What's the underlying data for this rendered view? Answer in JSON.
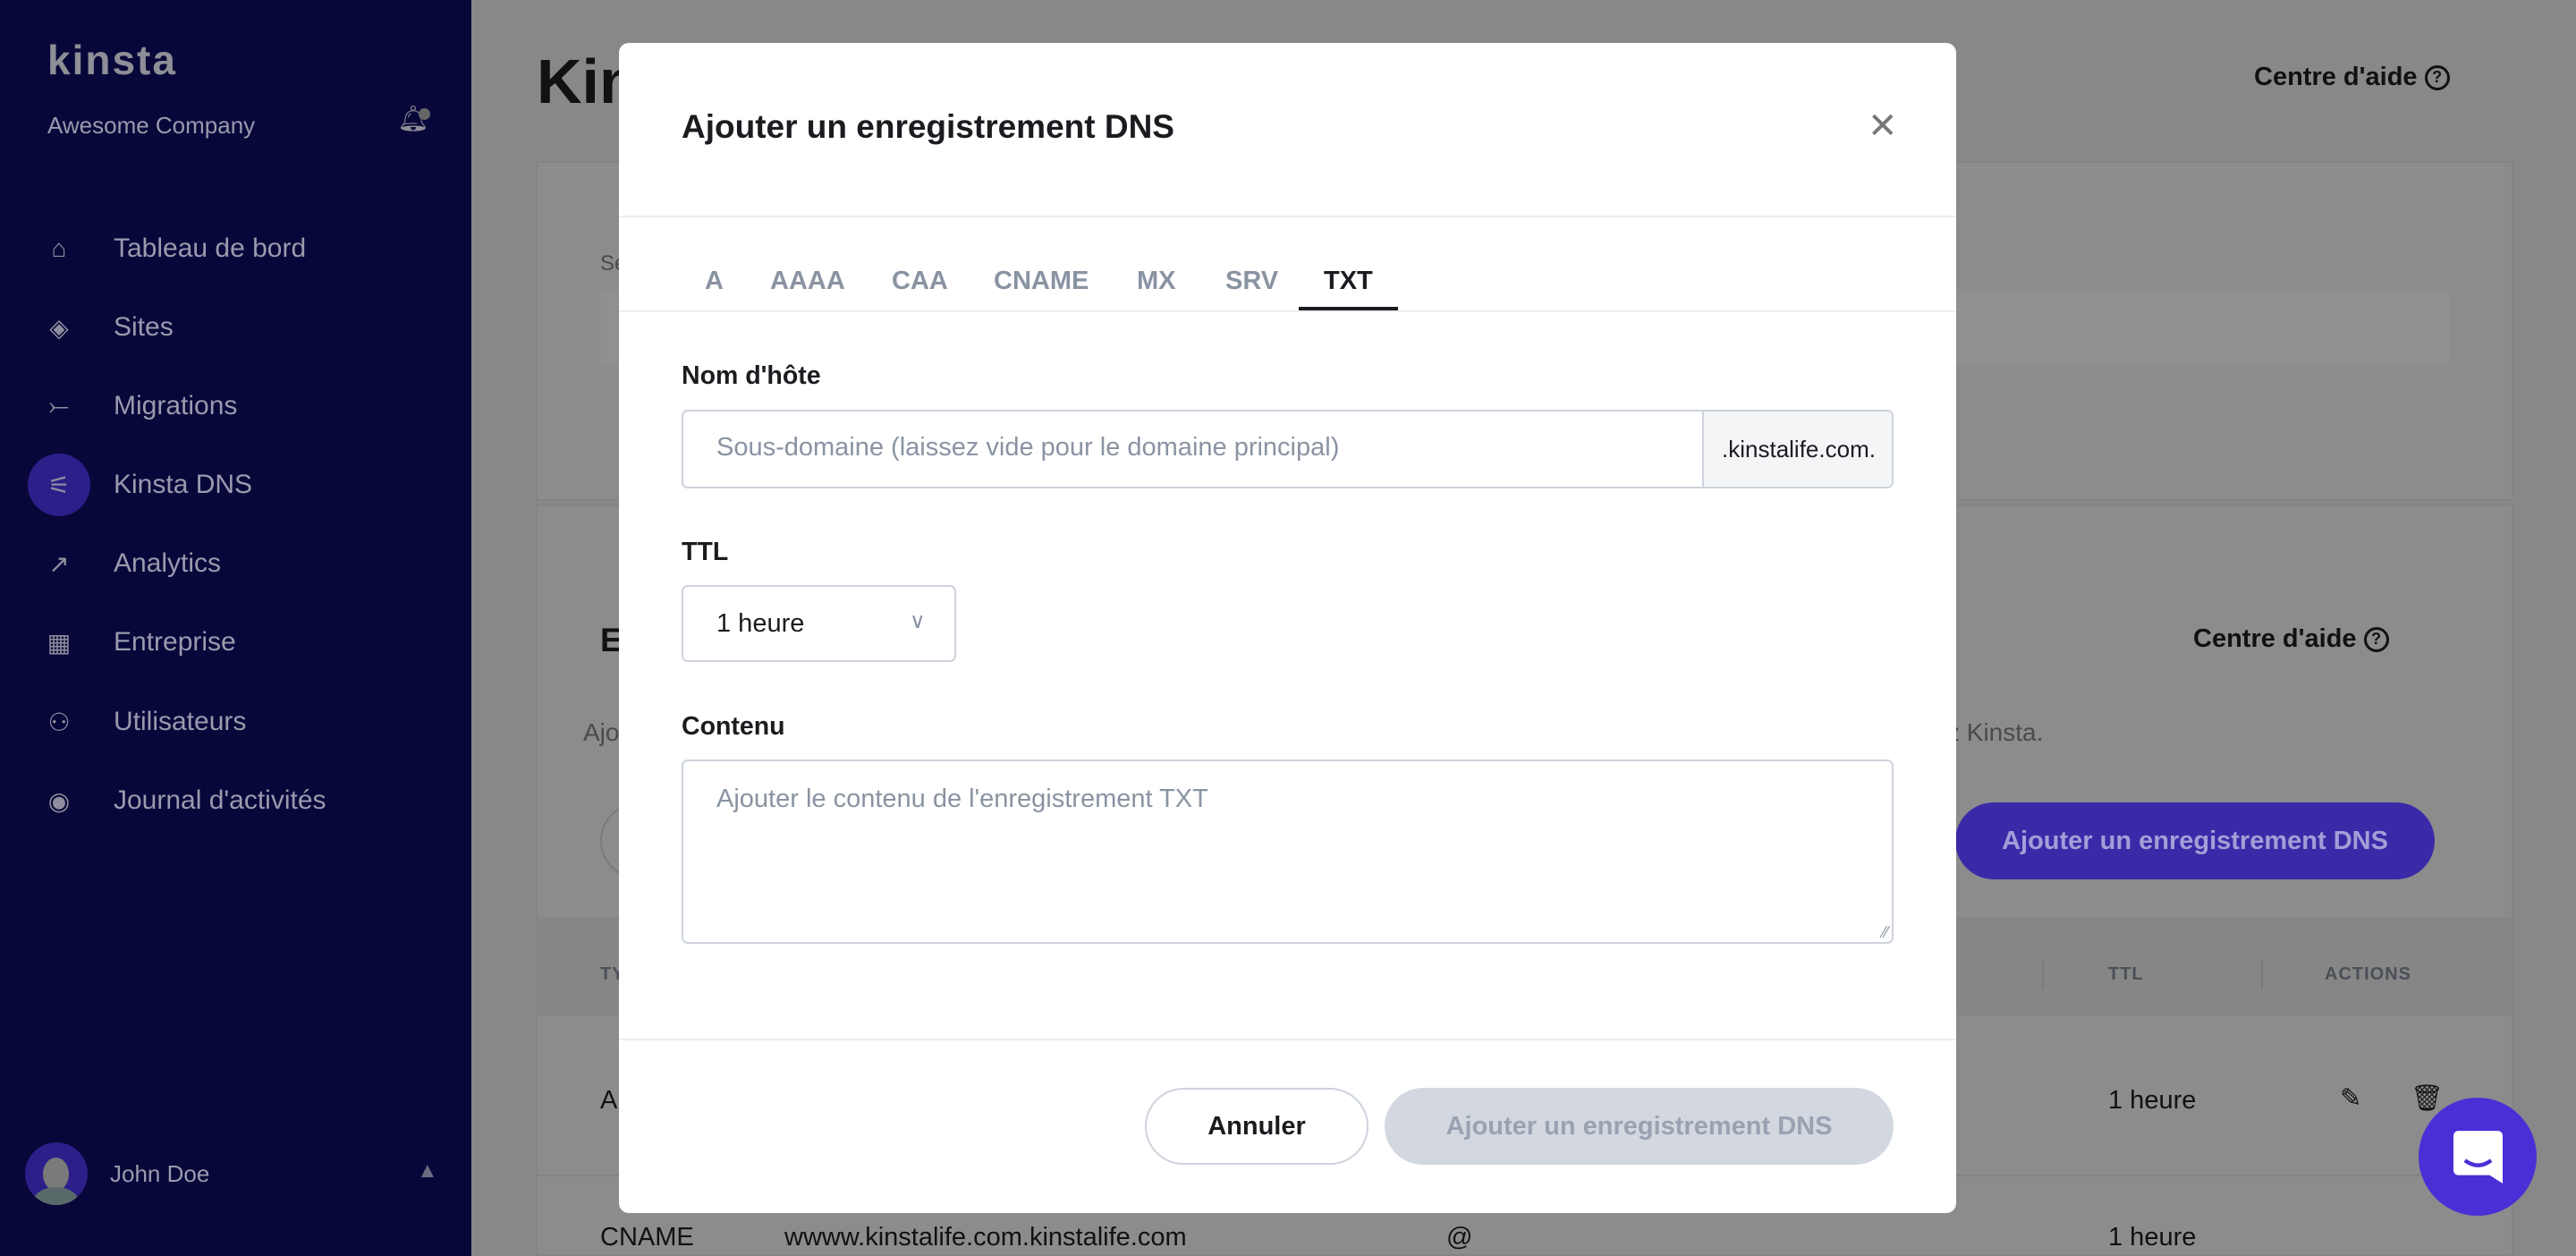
{
  "sidebar": {
    "logo": "kinsta",
    "company": "Awesome Company",
    "items": [
      {
        "label": "Tableau de bord",
        "icon": "home-icon"
      },
      {
        "label": "Sites",
        "icon": "layers-icon"
      },
      {
        "label": "Migrations",
        "icon": "migrations-icon"
      },
      {
        "label": "Kinsta DNS",
        "icon": "dns-icon",
        "active": true
      },
      {
        "label": "Analytics",
        "icon": "trend-icon"
      },
      {
        "label": "Entreprise",
        "icon": "building-icon"
      },
      {
        "label": "Utilisateurs",
        "icon": "user-plus-icon"
      },
      {
        "label": "Journal d'activités",
        "icon": "eye-icon"
      }
    ],
    "user": "John Doe"
  },
  "main": {
    "title": "Kin",
    "help": "Centre d'aide",
    "card1_label": "Se",
    "section_title": "E",
    "section_help": "Centre d'aide",
    "desc_left": "Ajo",
    "desc_right": "z Kinsta.",
    "add_button": "Ajouter un enregistrement DNS",
    "table": {
      "headers": {
        "type": "TY",
        "ttl": "TTL",
        "actions": "ACTIONS"
      },
      "rows": [
        {
          "type": "A",
          "name": "",
          "value": "",
          "ttl": "1 heure"
        },
        {
          "type": "CNAME",
          "name": "wwww.kinstalife.com.kinstalife.com",
          "value": "@",
          "ttl": "1 heure"
        }
      ]
    }
  },
  "modal": {
    "title": "Ajouter un enregistrement DNS",
    "tabs": [
      "A",
      "AAAA",
      "CAA",
      "CNAME",
      "MX",
      "SRV",
      "TXT"
    ],
    "active_tab": "TXT",
    "hostname_label": "Nom d'hôte",
    "hostname_placeholder": "Sous-domaine (laissez vide pour le domaine principal)",
    "hostname_suffix": ".kinstalife.com.",
    "ttl_label": "TTL",
    "ttl_value": "1 heure",
    "content_label": "Contenu",
    "content_placeholder": "Ajouter le contenu de l'enregistrement TXT",
    "cancel": "Annuler",
    "submit": "Ajouter un enregistrement DNS"
  },
  "colors": {
    "sidebar": "#07073a",
    "accent": "#4a2fd6",
    "disabled_button": "#d3d8e0"
  }
}
